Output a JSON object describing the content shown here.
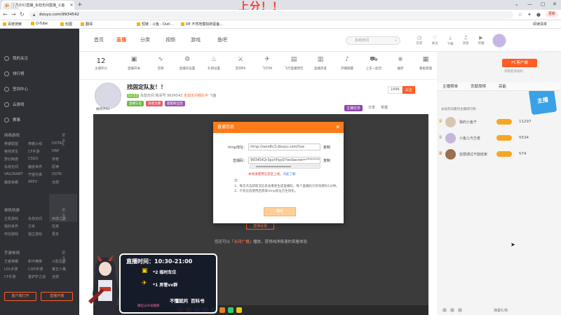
{
  "browser": {
    "tab_title": "磁场子ICi直播_永劫无间直播_斗鱼",
    "overlay_title": "上分！！",
    "url": "douyu.com/9934542",
    "update_label": "更新",
    "watermark": "斗鱼",
    "bookmarks": [
      "百度搜索",
      "O-Tube",
      "包图",
      "翻译",
      "短链 - 斗鱼 - Outl...",
      "RE 不然地模拟新驱备..."
    ],
    "reading_list": "阅读清单"
  },
  "site": {
    "logo": "斗鱼",
    "nav": [
      "首页",
      "直播",
      "分类",
      "视频",
      "游戏",
      "鱼吧"
    ],
    "active_nav": "直播",
    "search_placeholder": "永劫无间",
    "header_icons": [
      {
        "label": "历史",
        "icon": "clock-icon"
      },
      {
        "label": "关注",
        "icon": "heart-icon"
      },
      {
        "label": "下载",
        "icon": "download-icon"
      },
      {
        "label": "消息",
        "icon": "bell-icon"
      },
      {
        "label": "开播",
        "icon": "camera-icon"
      }
    ]
  },
  "sidebar": {
    "top_items": [
      "我的关注",
      "排行榜",
      "签到中心",
      "云游戏",
      "赛事"
    ],
    "sections": [
      {
        "title": "网络游戏",
        "more": "更多 >",
        "items": [
          "英雄联盟",
          "穿越火线",
          "DOTA2",
          "绝地求生",
          "CF手游",
          "DNF",
          "梦幻西游",
          "CSGO",
          "传奇",
          "永劫无间",
          "魔兽世界",
          "原神",
          "VALORANT",
          "守望先锋",
          "DOTA",
          "魔兽争霸",
          "APEX",
          "全部"
        ]
      },
      {
        "title": "单机热游",
        "more": "更多 >",
        "items": [
          "主机游戏",
          "永劫无间",
          "西游之路",
          "我的世界",
          "方舟",
          "饥荒",
          "怀旧游戏",
          "独立游戏",
          "更多"
        ]
      },
      {
        "title": "手游休闲",
        "more": "更多 >",
        "items": [
          "王者荣耀",
          "和平精英",
          "火影忍者",
          "LOL手游",
          "COD手游",
          "第五人格",
          "CF手游",
          "金铲铲之战",
          "全部"
        ]
      }
    ],
    "buttons": [
      "客户端打开",
      "直播开播"
    ]
  },
  "room": {
    "follower_count": "12",
    "follower_label": "主播积分",
    "tools": [
      "直播开关",
      "音频",
      "直播间设置",
      "礼物设置",
      "签到PK",
      "飞行PK",
      "飞行直播预告",
      "直播热度",
      "开播提醒",
      "上车一起玩",
      "抽奖",
      "看板管理",
      "更多"
    ],
    "title": "找固定队友！！",
    "meta_category": "永劫无间",
    "meta_level": "Lv.12",
    "meta_id": "房间号 9934542",
    "meta_warn": "永劫无间组队中",
    "meta_extra": "飞鱼",
    "tags": [
      "直播认证",
      "高能主播",
      "超能粉丝团"
    ],
    "nickname": "磁场子ICi",
    "follow_count": "1896",
    "follow_label": "关注",
    "share": "分享",
    "report": "举报",
    "extra_badge": "主播任务"
  },
  "player": {
    "tip_prefix": "您还可以「",
    "tip_link": "关闭广播",
    "tip_suffix": "」播放，获得纯净极速的观看体验",
    "button": "直播设置"
  },
  "modal": {
    "title": "直播信息",
    "rtmp_label": "rtmp地址：",
    "rtmp_value": "rtmp://sendtc3.douyu.com/live",
    "rtmp_copy": "复制",
    "code_label": "直播码：",
    "code_value": "9934542r3pchFpyD?wsSecret=********",
    "code_copy": "复制",
    "warning": "本地请使用信息后上线，",
    "warning_link": "点此了解",
    "note_title": "注：",
    "notes": [
      "1、每次点击获取流信息会重新生成直播码，每个直播码只有效期为1分钟。",
      "2、只有信息使用后获取rtmp地址方生效化。"
    ],
    "confirm": "确定"
  },
  "right": {
    "pc_button": "PC客户端",
    "pc_sub": "领取超值福利",
    "tabs": [
      "主播榜单",
      "贡献周榜",
      "高能"
    ],
    "desc": "永劫无间最热主播排行榜",
    "ranks": [
      {
        "name": "我的小鱼干",
        "score": "11297",
        "crown": "♛",
        "crown_color": "#f5a623",
        "avatar_color": "#d8c6b5"
      },
      {
        "name": "小鱼儿与王者",
        "score": "5534",
        "crown": "♛",
        "crown_color": "#b0b0b0",
        "avatar_color": "#c4b7d9"
      },
      {
        "name": "亚顺通过不能结束",
        "score": "574",
        "crown": "♛",
        "crown_color": "#c8865a",
        "avatar_color": "#9b6f4e"
      }
    ],
    "games_logo": "主播",
    "chat_action": "弹幕礼物"
  },
  "schedule": {
    "title": "直播时间：",
    "time": "10:30-21:00",
    "items": [
      {
        "prefix": "*2",
        "text": "临时车位",
        "icon": "▣"
      },
      {
        "prefix": "*1",
        "text": "房管vx群",
        "icon": "✈"
      }
    ],
    "foot1": "不懂就问",
    "foot2": "百科书",
    "footer_tag": "微信公众号搜索"
  }
}
